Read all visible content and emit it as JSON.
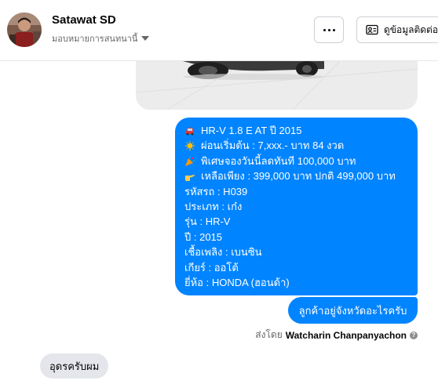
{
  "header": {
    "name": "Satawat SD",
    "subtitle": "มอบหมายการสนทนานี้",
    "more_icon": "more-dots-icon",
    "contact_button": "ดูข้อมูลติดต่อ",
    "contact_icon": "contact-card-icon"
  },
  "conversation": {
    "image_attachment": "car-photo",
    "message_lines": [
      {
        "icon": "car-emoji",
        "color": "#e53935",
        "text": "HR-V 1.8 E AT ปี 2015"
      },
      {
        "icon": "sparkle-emoji",
        "color": "#ffc107",
        "text": "ผ่อนเริ่มต้น : 7,xxx.- บาท 84 งวด"
      },
      {
        "icon": "party-popper-emoji",
        "color": "#ff9800",
        "text": "พิเศษจองวันนี้ลดทันที 100,000 บาท"
      },
      {
        "icon": "pointing-hand-emoji",
        "color": "#ffcc4d",
        "text": "เหลือเพียง : 399,000 บาท ปกติ 499,000 บาท"
      },
      {
        "text": "รหัสรถ : H039"
      },
      {
        "text": "ประเภท : เก๋ง"
      },
      {
        "text": "รุ่น : HR-V"
      },
      {
        "text": "ปี : 2015"
      },
      {
        "text": "เชื้อเพลิง : เบนซิน"
      },
      {
        "text": "เกียร์ : ออโต้"
      },
      {
        "text": "ยี่ห้อ : HONDA (ฮอนด้า)"
      }
    ],
    "question": "ลูกค้าอยู่จังหวัดอะไรครับ",
    "sent_by_prefix": "ส่งโดย",
    "sent_by_name": "Watcharin Chanpanyachon",
    "reply": "อุดรครับผม"
  }
}
